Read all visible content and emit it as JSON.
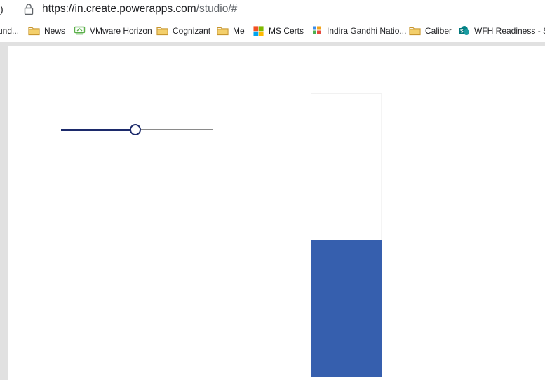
{
  "browser": {
    "left_edge_glyph": ")",
    "url_domain": "https://in.create.powerapps.com",
    "url_path": "/studio/#"
  },
  "bookmarks": [
    {
      "label": "und...",
      "icon": "none"
    },
    {
      "label": "News",
      "icon": "folder-icon"
    },
    {
      "label": "VMware Horizon",
      "icon": "vmware-horizon-icon"
    },
    {
      "label": "Cognizant",
      "icon": "folder-icon"
    },
    {
      "label": "Me",
      "icon": "folder-icon"
    },
    {
      "label": "MS Certs",
      "icon": "microsoft-logo-icon"
    },
    {
      "label": "Indira Gandhi Natio...",
      "icon": "colored-squares-icon"
    },
    {
      "label": "Caliber",
      "icon": "folder-icon"
    },
    {
      "label": "WFH Readiness - S...",
      "icon": "sharepoint-icon"
    }
  ],
  "app": {
    "slider_value_fraction": 0.49,
    "gauge_fill_fraction": 0.485
  },
  "colors": {
    "slider_accent": "#1c2a6b",
    "slider_rail": "#8a8a8a",
    "gauge_fill": "#365fae",
    "folder": "#e8b84a",
    "chrome_gray": "#e1e1e1"
  }
}
